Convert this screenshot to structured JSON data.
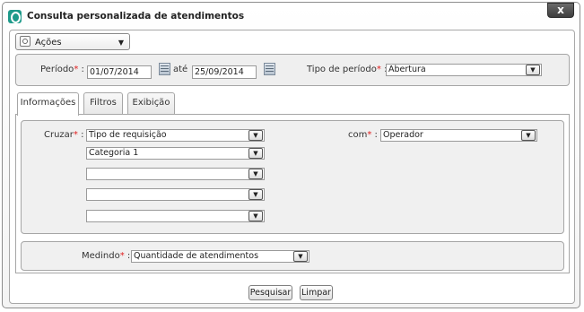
{
  "window": {
    "title": "Consulta personalizada de atendimentos",
    "close_label": "x"
  },
  "actions_menu": {
    "label": "Ações"
  },
  "periodo": {
    "label": "Período",
    "start": "01/07/2014",
    "ate_label": "até",
    "end": "25/09/2014",
    "tipo_label": "Tipo de período",
    "tipo_value": "Abertura"
  },
  "tabs": [
    {
      "label": "Informações"
    },
    {
      "label": "Filtros"
    },
    {
      "label": "Exibição"
    }
  ],
  "informacoes": {
    "cruzar_label": "Cruzar",
    "cruzar_values": [
      "Tipo de requisição",
      "Categoria 1",
      "",
      "",
      ""
    ],
    "com_label": "com",
    "com_value": "Operador",
    "medindo_label": "Medindo",
    "medindo_value": "Quantidade de atendimentos"
  },
  "buttons": {
    "pesquisar": "Pesquisar",
    "limpar": "Limpar"
  },
  "colors": {
    "accent": "#1e9a8a",
    "required": "#e02020"
  },
  "icons": {
    "app": "app-logo-icon",
    "close": "close-icon",
    "actions": "gear-icon",
    "calendar": "calendar-icon",
    "dropdown": "chevron-down-icon"
  }
}
